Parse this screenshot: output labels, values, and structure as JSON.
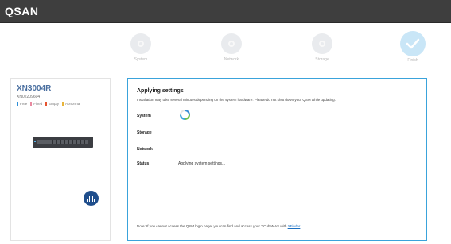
{
  "header": {
    "logo_text": "QSAN"
  },
  "wizard": {
    "steps": [
      {
        "label": "System",
        "state": "done"
      },
      {
        "label": "Network",
        "state": "done"
      },
      {
        "label": "Storage",
        "state": "done"
      },
      {
        "label": "Finish",
        "state": "active"
      }
    ]
  },
  "device": {
    "model": "XN3004R",
    "serial": "XN02209604",
    "legend": [
      {
        "label": "Free",
        "color": "#2e8fd8"
      },
      {
        "label": "Fixed",
        "color": "#e88aa0"
      },
      {
        "label": "Empty",
        "color": "#e6542f"
      },
      {
        "label": "Abnormal",
        "color": "#e8b43a"
      }
    ]
  },
  "main": {
    "title": "Applying settings",
    "note": "Installation may take several minutes depending on the system hardware. Please do not shut down your QSM while updating.",
    "rows": {
      "system": "System",
      "storage": "Storage",
      "network": "Network",
      "status": "Status"
    },
    "status_text": "Applying system settings...",
    "footer_note": "Note: If you cannot access the QSM login page, you can find and access your XCubeNAS with ",
    "footer_link": "XFinder"
  },
  "colors": {
    "accent": "#3aa3db",
    "topbar": "#3e3e3e"
  }
}
